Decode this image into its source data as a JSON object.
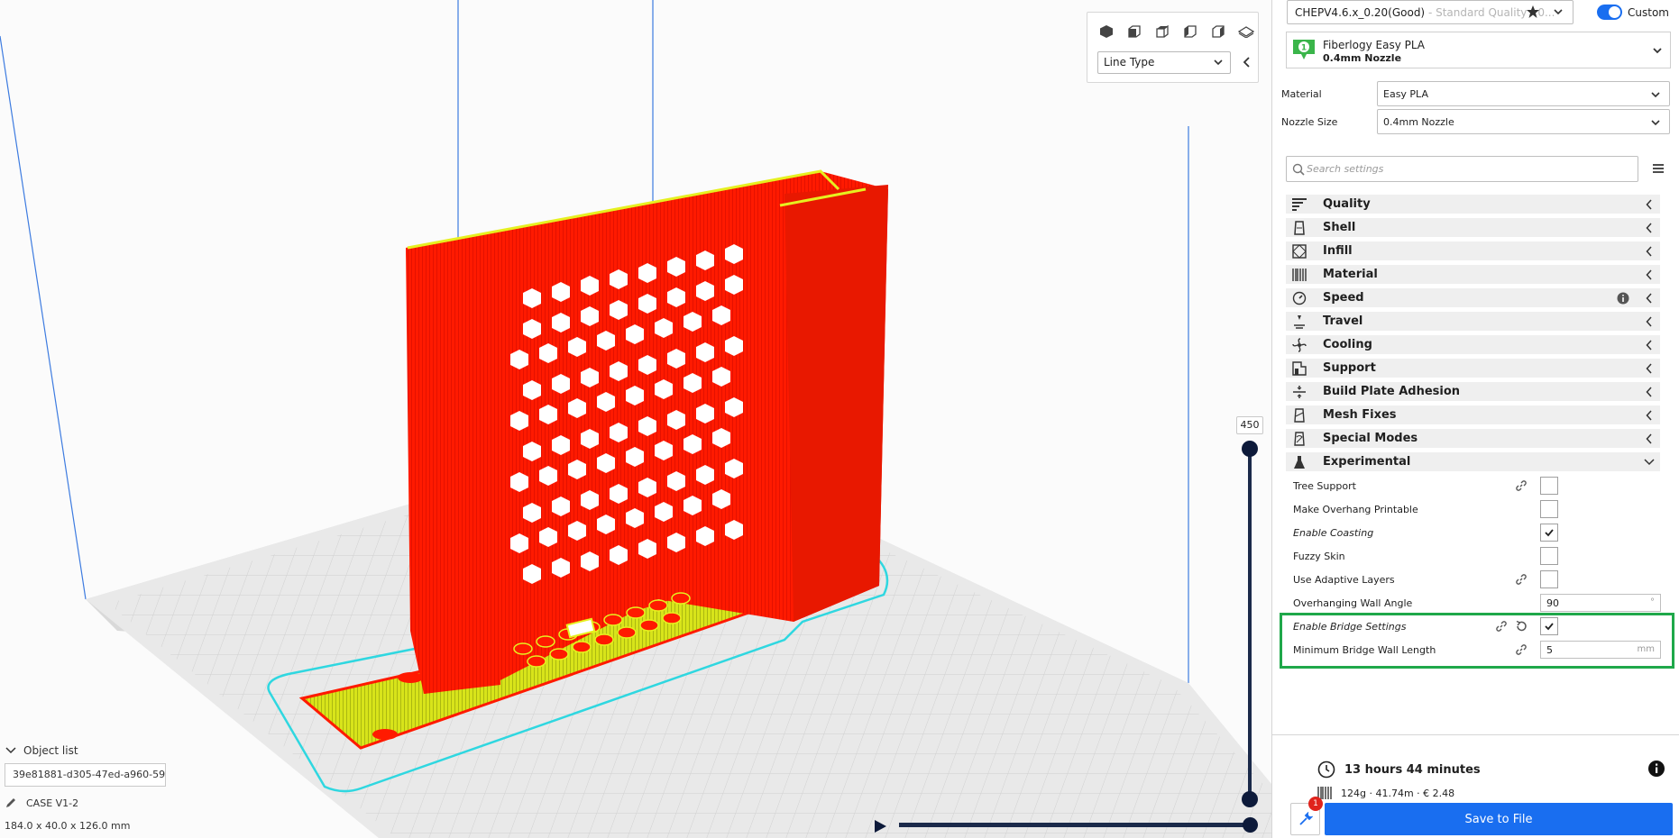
{
  "view": {
    "line_type": "Line Type",
    "layer_value": "450"
  },
  "object_list": {
    "header": "Object list",
    "object_id": "39e81881-d305-47ed-a960-59...",
    "object_name": "CASE V1-2",
    "dimensions": "184.0 x 40.0 x 126.0 mm"
  },
  "profile": {
    "name": "CHEPV4.6.x_0.20(Good)",
    "subtitle": " - Standard Quality - 0...",
    "custom_label": "Custom"
  },
  "extruder": {
    "material": "Fiberlogy Easy PLA",
    "nozzle": "0.4mm Nozzle",
    "badge": "1"
  },
  "material_field": {
    "label": "Material",
    "value": "Easy PLA"
  },
  "nozzle_field": {
    "label": "Nozzle Size",
    "value": "0.4mm Nozzle"
  },
  "search": {
    "placeholder": "Search settings"
  },
  "categories": [
    {
      "label": "Quality",
      "icon": "quality-icon"
    },
    {
      "label": "Shell",
      "icon": "shell-icon"
    },
    {
      "label": "Infill",
      "icon": "infill-icon"
    },
    {
      "label": "Material",
      "icon": "material-icon"
    },
    {
      "label": "Speed",
      "icon": "speed-icon"
    },
    {
      "label": "Travel",
      "icon": "travel-icon"
    },
    {
      "label": "Cooling",
      "icon": "cooling-icon"
    },
    {
      "label": "Support",
      "icon": "support-icon"
    },
    {
      "label": "Build Plate Adhesion",
      "icon": "adhesion-icon"
    },
    {
      "label": "Mesh Fixes",
      "icon": "mesh-fixes-icon"
    },
    {
      "label": "Special Modes",
      "icon": "special-modes-icon"
    },
    {
      "label": "Experimental",
      "icon": "experimental-icon"
    }
  ],
  "experimental_settings": [
    {
      "label": "Tree Support",
      "type": "checkbox",
      "checked": false
    },
    {
      "label": "Make Overhang Printable",
      "type": "checkbox",
      "checked": false
    },
    {
      "label": "Enable Coasting",
      "type": "checkbox",
      "checked": true
    },
    {
      "label": "Fuzzy Skin",
      "type": "checkbox",
      "checked": false
    },
    {
      "label": "Use Adaptive Layers",
      "type": "checkbox",
      "checked": false
    },
    {
      "label": "Overhanging Wall Angle",
      "type": "number",
      "value": "90",
      "unit": "°"
    },
    {
      "label": "Enable Bridge Settings",
      "type": "checkbox",
      "checked": true
    },
    {
      "label": "Minimum Bridge Wall Length",
      "type": "number",
      "value": "5",
      "unit": "mm"
    }
  ],
  "footer": {
    "print_time": "13 hours 44 minutes",
    "stats": "124g · 41.74m · € 2.48",
    "save_label": "Save to File",
    "badge": "1"
  },
  "colors": {
    "accent": "#196ef0",
    "model_red": "#ff1a00",
    "model_yellow": "#e6f020",
    "highlight": "#1fa84a",
    "outline": "#2fd7e0"
  }
}
